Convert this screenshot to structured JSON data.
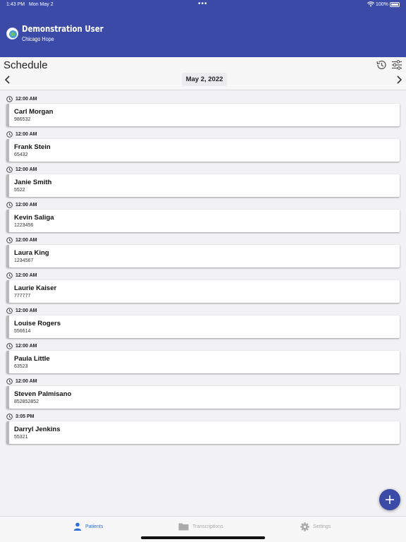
{
  "status_bar": {
    "time": "1:43 PM",
    "date": "Mon May 2",
    "battery": "100%"
  },
  "header": {
    "user_name": "Demonstration User",
    "org_name": "Chicago Hope"
  },
  "toolbar": {
    "title": "Schedule",
    "date": "May 2, 2022"
  },
  "appointments": [
    {
      "time": "12:00 AM",
      "name": "Carl Morgan",
      "id": "986532"
    },
    {
      "time": "12:00 AM",
      "name": "Frank Stein",
      "id": "65432"
    },
    {
      "time": "12:00 AM",
      "name": "Janie Smith",
      "id": "5522"
    },
    {
      "time": "12:00 AM",
      "name": "Kevin Saliga",
      "id": "1223456"
    },
    {
      "time": "12:00 AM",
      "name": "Laura King",
      "id": "1234567"
    },
    {
      "time": "12:00 AM",
      "name": "Laurie Kaiser",
      "id": "777777"
    },
    {
      "time": "12:00 AM",
      "name": "Louise Rogers",
      "id": "556614"
    },
    {
      "time": "12:00 AM",
      "name": "Paula Little",
      "id": "63523"
    },
    {
      "time": "12:00 AM",
      "name": "Steven Palmisano",
      "id": "852852852"
    },
    {
      "time": "3:05 PM",
      "name": "Darryl Jenkins",
      "id": "55321"
    }
  ],
  "tabs": [
    {
      "label": "Patients",
      "icon": "person-icon",
      "active": true
    },
    {
      "label": "Transcriptions",
      "icon": "folder-icon",
      "active": false
    },
    {
      "label": "Settings",
      "icon": "gear-icon",
      "active": false
    }
  ],
  "colors": {
    "header": "#3a4aa6",
    "accent": "#2f6fd8",
    "card_border": "#b8b8bc"
  }
}
